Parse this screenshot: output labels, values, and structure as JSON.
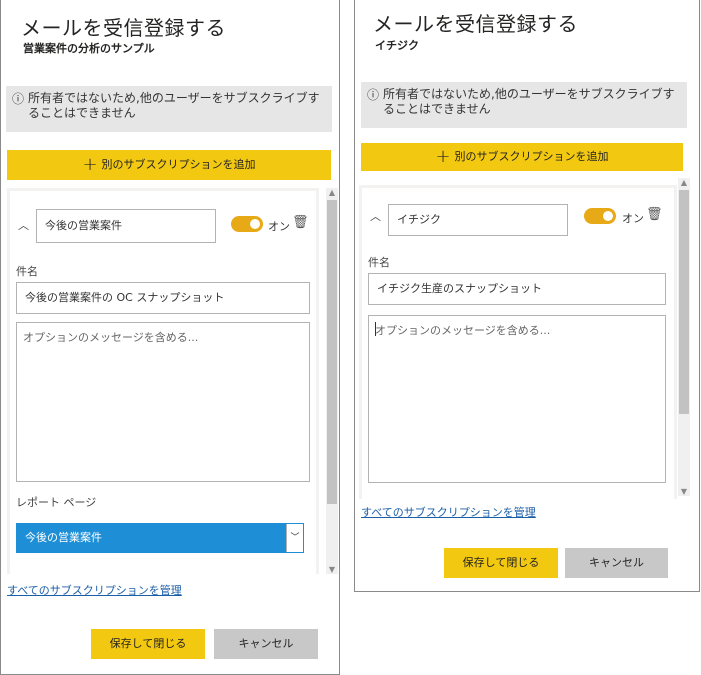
{
  "left": {
    "title": "メールを受信登録する",
    "subtitle": "営業案件の分析のサンプル",
    "info_icon": "ⓘ",
    "info_text": "所有者ではないため,他のユーザーをサブスクライブすることはできません",
    "add_label": "別のサブスクリプションを追加",
    "subscription_name": "今後の営業案件",
    "toggle_label": "オン",
    "subject_label": "件名",
    "subject_value": "今後の営業案件の OC スナップショット",
    "message_placeholder": "オプションのメッセージを含める...",
    "report_page_label": "レポート ページ",
    "report_page_value": "今後の営業案件",
    "manage_link": "すべてのサブスクリプションを管理",
    "save_label": "保存して閉じる",
    "cancel_label": "キャンセル"
  },
  "right": {
    "title": "メールを受信登録する",
    "subtitle": "イチジク",
    "info_icon": "ⓘ",
    "info_text": "所有者ではないため,他のユーザーをサブスクライブすることはできません",
    "add_label": "別のサブスクリプションを追加",
    "subscription_name": "イチジク",
    "toggle_label": "オン",
    "subject_label": "件名",
    "subject_value": "イチジク生産のスナップショット",
    "message_placeholder": "オプションのメッセージを含める...",
    "manage_link": "すべてのサブスクリプションを管理",
    "save_label": "保存して閉じる",
    "cancel_label": "キャンセル"
  },
  "icons": {
    "plus": "plus-icon",
    "chevron_up": "chevron-up-icon",
    "trash": "trash-icon",
    "info": "info-icon",
    "chevron_down": "chevron-down-icon"
  },
  "colors": {
    "accent_yellow": "#f2c811",
    "toggle_on": "#e8a916",
    "select_blue": "#1e8fd6",
    "link_blue": "#1a5ea8",
    "info_bg": "#e6e6e6",
    "card_bg": "#f3f2f1"
  }
}
